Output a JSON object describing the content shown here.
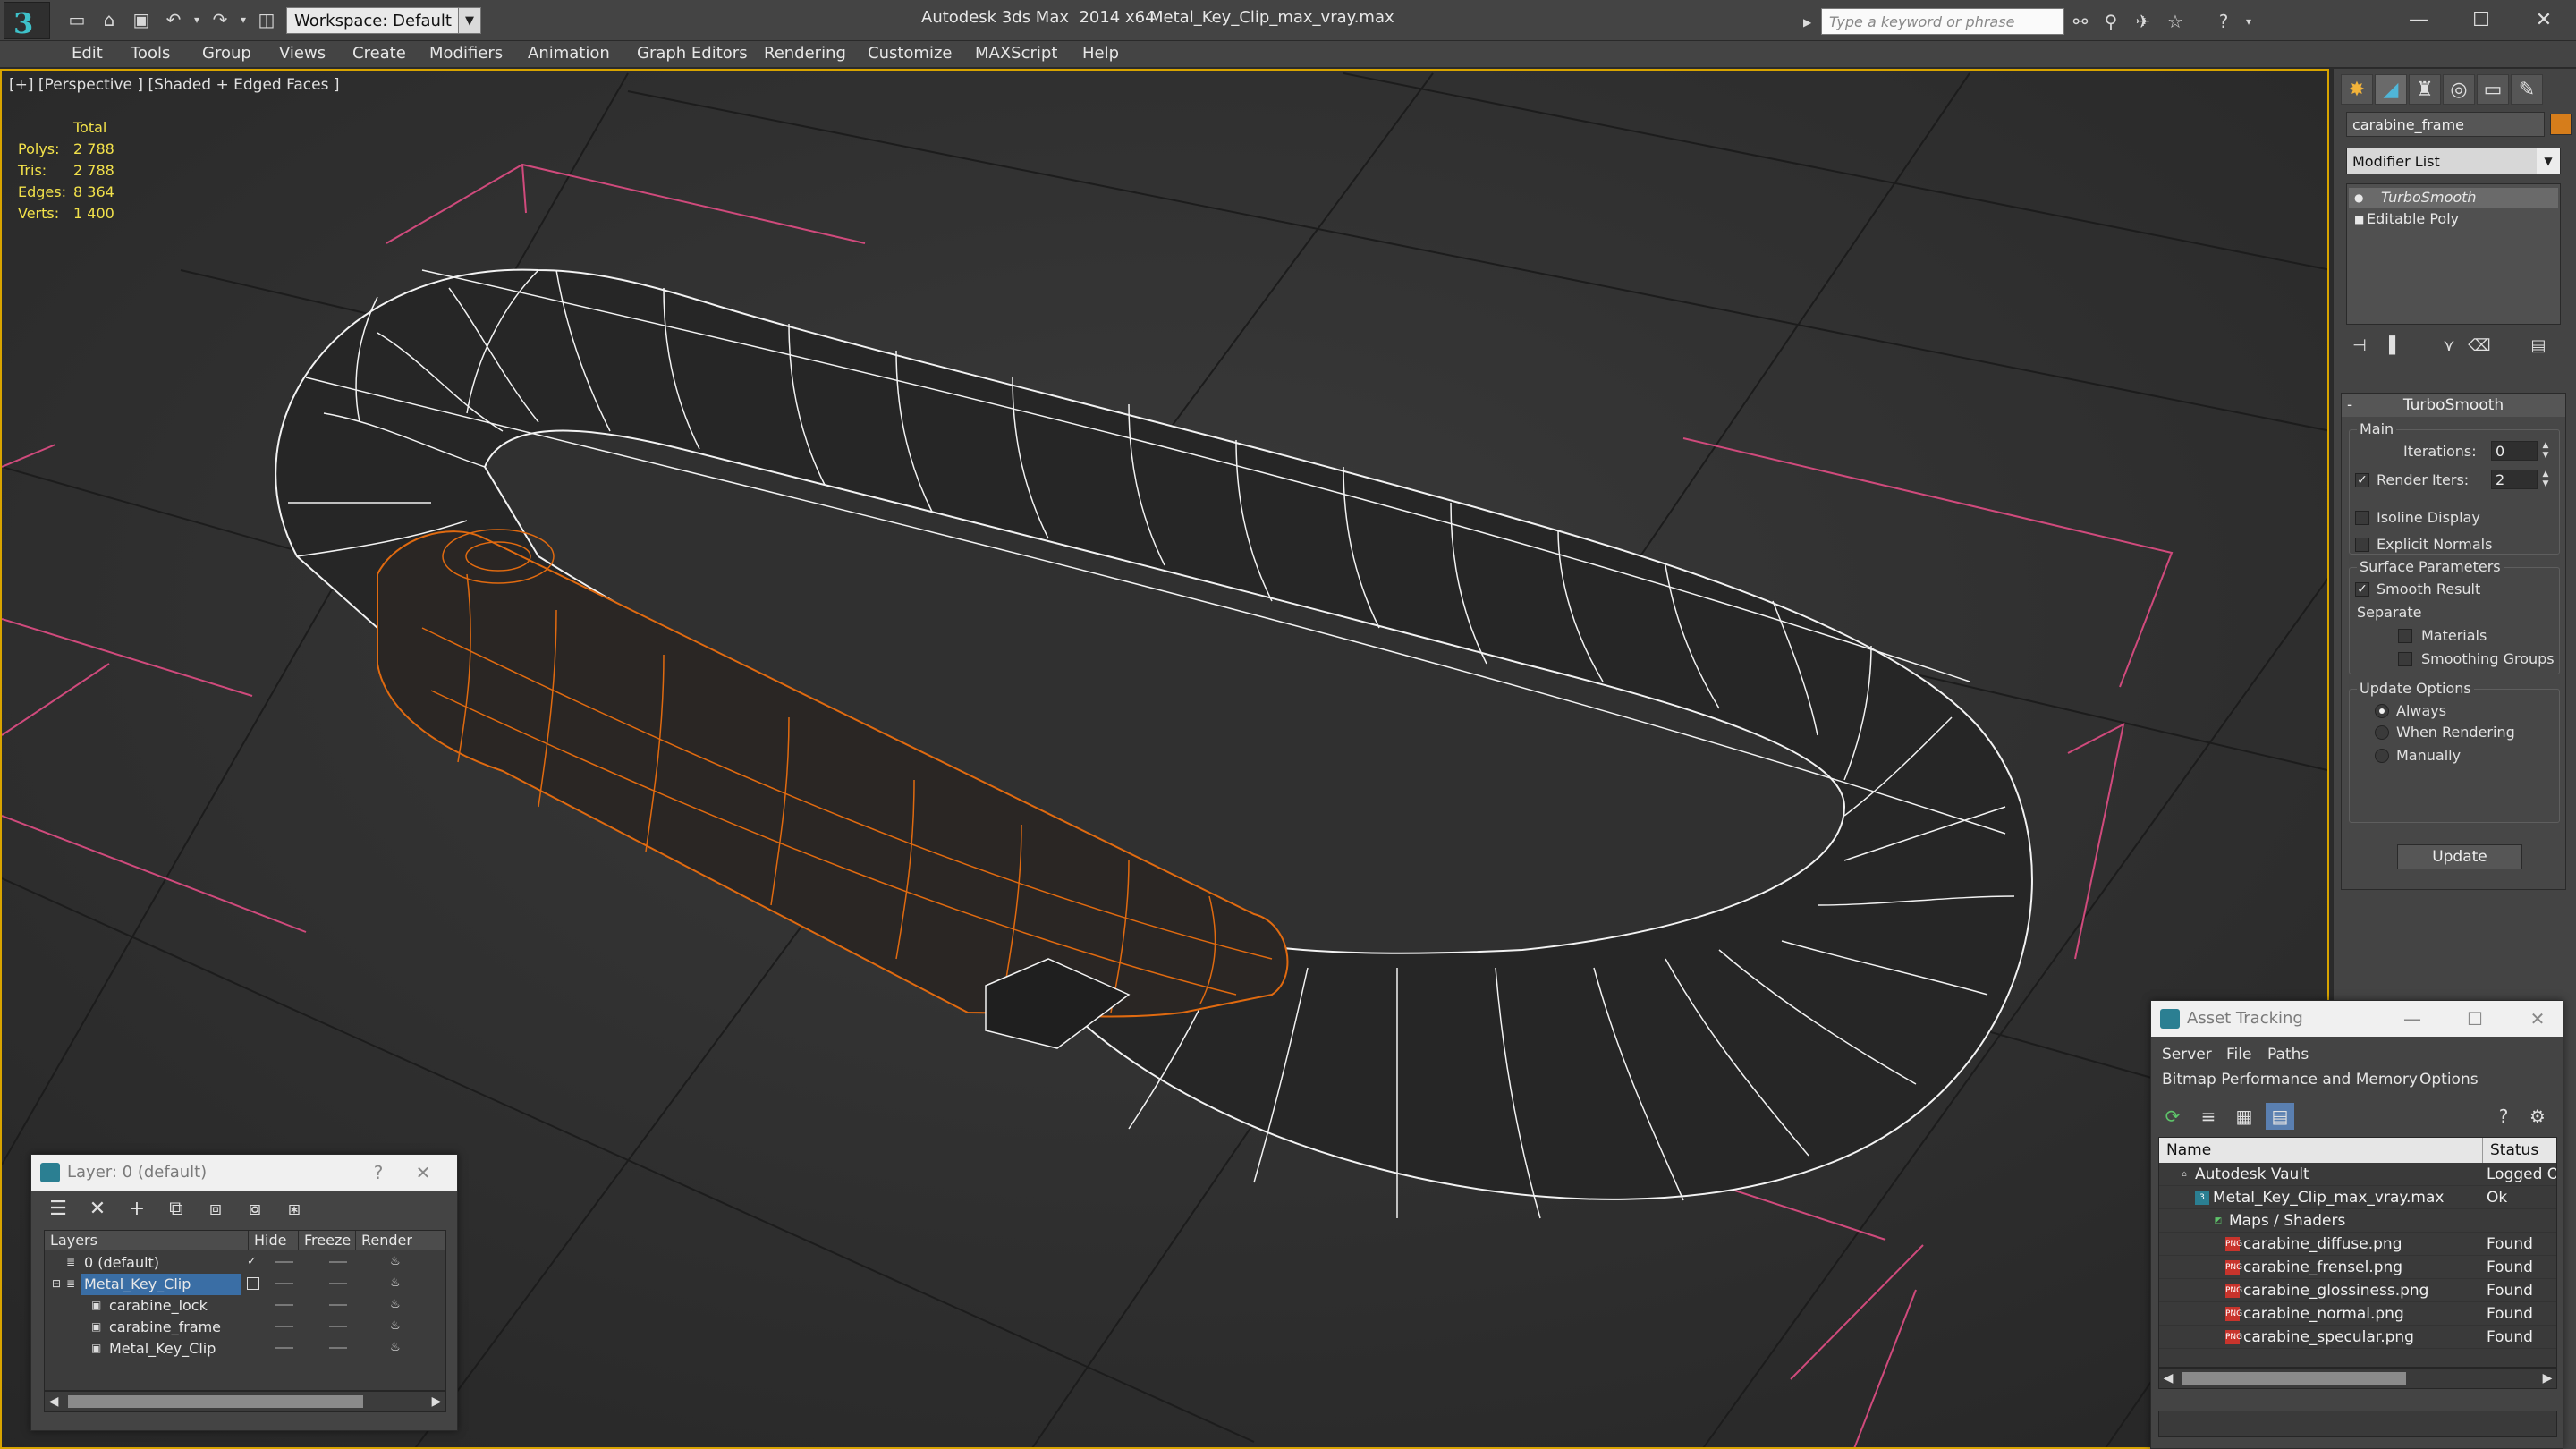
{
  "titlebar": {
    "workspace": "Workspace: Default",
    "app_title": "Autodesk 3ds Max  2014 x64",
    "file_name": "Metal_Key_Clip_max_vray.max",
    "search_placeholder": "Type a keyword or phrase"
  },
  "menu": [
    "Edit",
    "Tools",
    "Group",
    "Views",
    "Create",
    "Modifiers",
    "Animation",
    "Graph Editors",
    "Rendering",
    "Customize",
    "MAXScript",
    "Help"
  ],
  "viewport": {
    "label": "[+] [Perspective ] [Shaded + Edged Faces ]",
    "stats": {
      "header": "Total",
      "rows": [
        {
          "label": "Polys:",
          "value": "2 788"
        },
        {
          "label": "Tris:",
          "value": "2 788"
        },
        {
          "label": "Edges:",
          "value": "8 364"
        },
        {
          "label": "Verts:",
          "value": "1 400"
        }
      ]
    },
    "colors": {
      "selection_wire": "#e06a10",
      "mesh_wire": "#f2f2f2",
      "grid_line": "#1a1a1a",
      "light_target": "#d9487a",
      "active_border": "#d8a400"
    }
  },
  "command_panel": {
    "object_name": "carabine_frame",
    "object_color": "#d67d1b",
    "modifier_list": "Modifier List",
    "stack": [
      {
        "label": "TurboSmooth",
        "selected": true
      },
      {
        "label": "Editable Poly",
        "selected": false
      }
    ],
    "rollout": {
      "title": "TurboSmooth",
      "main_group": "Main",
      "iterations_label": "Iterations:",
      "iterations_value": "0",
      "render_iters_label": "Render Iters:",
      "render_iters_value": "2",
      "isoline_label": "Isoline Display",
      "explicit_normals_label": "Explicit Normals",
      "surface_group": "Surface Parameters",
      "smooth_result_label": "Smooth Result",
      "separate_label": "Separate",
      "materials_label": "Materials",
      "smoothing_groups_label": "Smoothing Groups",
      "update_group": "Update Options",
      "always_label": "Always",
      "when_rendering_label": "When Rendering",
      "manually_label": "Manually",
      "update_button": "Update"
    }
  },
  "layer_window": {
    "title": "Layer: 0 (default)",
    "help": "?",
    "close": "✕",
    "columns": [
      "Layers",
      "Hide",
      "Freeze",
      "Render"
    ],
    "rows": [
      {
        "name": "0 (default)",
        "level": 0,
        "selected": false,
        "type": "layer"
      },
      {
        "name": "Metal_Key_Clip",
        "level": 0,
        "selected": true,
        "type": "layer"
      },
      {
        "name": "carabine_lock",
        "level": 1,
        "selected": false,
        "type": "object"
      },
      {
        "name": "carabine_frame",
        "level": 1,
        "selected": false,
        "type": "object"
      },
      {
        "name": "Metal_Key_Clip",
        "level": 1,
        "selected": false,
        "type": "object"
      }
    ]
  },
  "asset_window": {
    "title": "Asset Tracking",
    "menu_row1": [
      "Server",
      "File",
      "Paths"
    ],
    "menu_row2": [
      "Bitmap Performance and Memory",
      "Options"
    ],
    "columns": [
      "Name",
      "Status"
    ],
    "rows": [
      {
        "name": "Autodesk Vault",
        "status": "Logged O",
        "level": 0,
        "icon": "vault"
      },
      {
        "name": "Metal_Key_Clip_max_vray.max",
        "status": "Ok",
        "level": 1,
        "icon": "max"
      },
      {
        "name": "Maps / Shaders",
        "status": "",
        "level": 2,
        "icon": "maps"
      },
      {
        "name": "carabine_diffuse.png",
        "status": "Found",
        "level": 3,
        "icon": "png"
      },
      {
        "name": "carabine_frensel.png",
        "status": "Found",
        "level": 3,
        "icon": "png"
      },
      {
        "name": "carabine_glossiness.png",
        "status": "Found",
        "level": 3,
        "icon": "png"
      },
      {
        "name": "carabine_normal.png",
        "status": "Found",
        "level": 3,
        "icon": "png"
      },
      {
        "name": "carabine_specular.png",
        "status": "Found",
        "level": 3,
        "icon": "png"
      }
    ]
  }
}
